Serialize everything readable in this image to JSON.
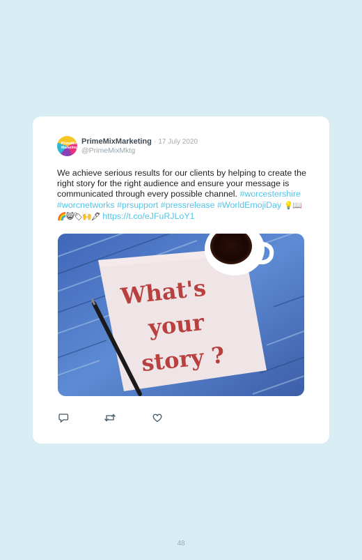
{
  "tweet": {
    "avatar_text": "PrimeMix Marketing",
    "author_name": "PrimeMixMarketing",
    "separator": "·",
    "date": "17 July 2020",
    "handle": "@PrimeMixMktg",
    "body_text": "We achieve serious results for our clients by helping to create the right story for the right audience and ensure your message is communicated through every possible channel.",
    "hashtags": [
      "#worcestershire",
      "#worcnetworks",
      "#prsupport",
      "#pressrelease",
      "#WorldEmojiDay"
    ],
    "emojis": "💡📖🌈😸🏷🙌🖋",
    "link": "https://t.co/eJFuRJLoY1",
    "image": {
      "napkin_text_line1": "What's",
      "napkin_text_line2": "your",
      "napkin_text_line3": "story ?"
    },
    "actions": [
      "reply-icon",
      "retweet-icon",
      "like-icon"
    ]
  },
  "page": {
    "number": "48"
  },
  "colors": {
    "background": "#d8edf3",
    "card": "#ffffff",
    "hashtag": "#55c3e6",
    "icon": "#3e5666"
  }
}
